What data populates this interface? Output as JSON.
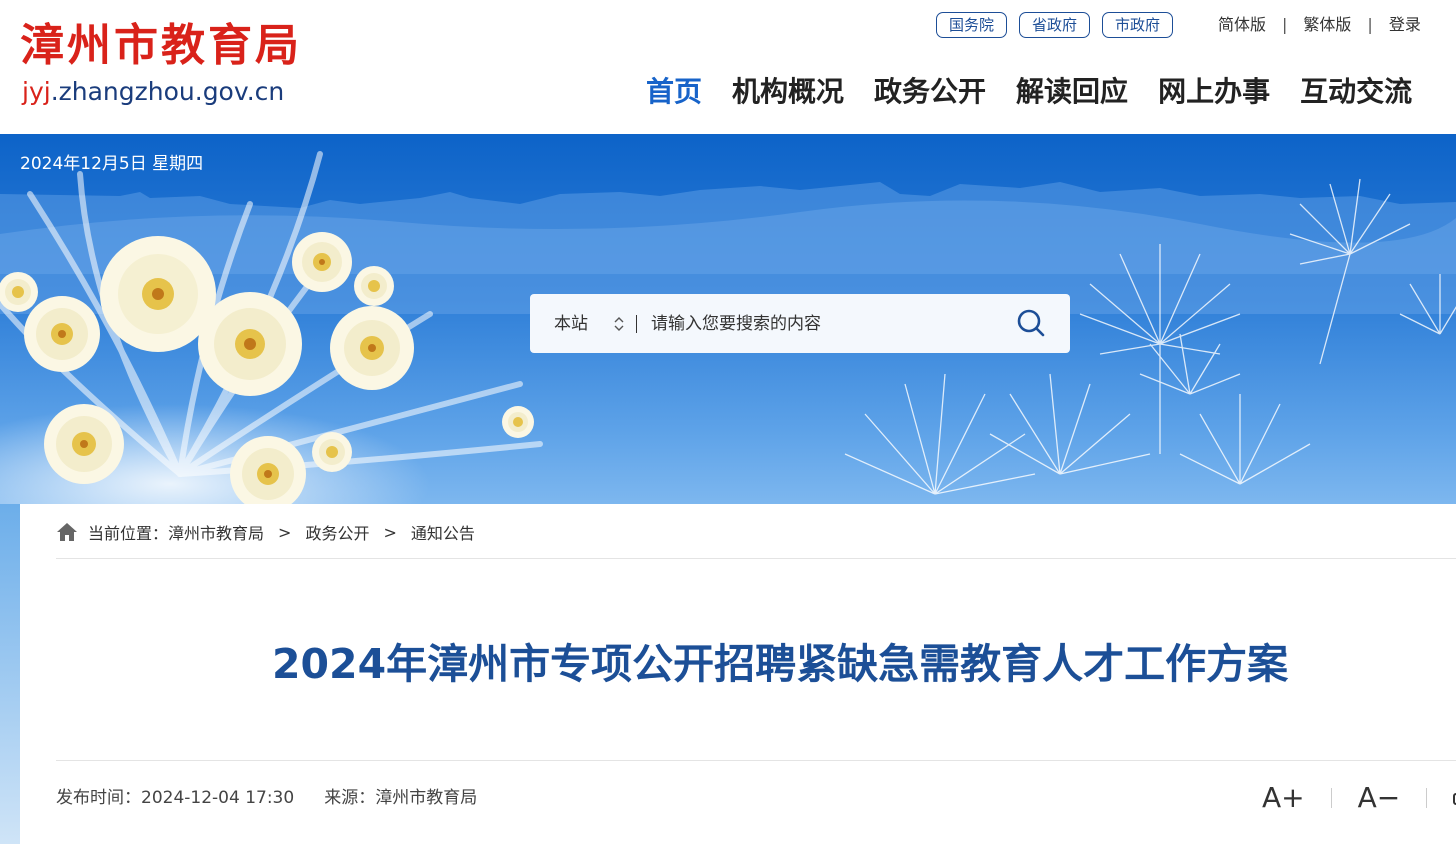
{
  "header": {
    "site_title": "漳州市教育局",
    "site_url_prefix": "jyj",
    "site_url_rest": ".zhangzhou.gov.cn",
    "gov_links": [
      {
        "label": "国务院"
      },
      {
        "label": "省政府"
      },
      {
        "label": "市政府"
      }
    ],
    "util_links": {
      "simplified": "简体版",
      "traditional": "繁体版",
      "login": "登录",
      "separator": "|"
    },
    "nav": [
      {
        "label": "首页",
        "active": true
      },
      {
        "label": "机构概况",
        "active": false
      },
      {
        "label": "政务公开",
        "active": false
      },
      {
        "label": "解读回应",
        "active": false
      },
      {
        "label": "网上办事",
        "active": false
      },
      {
        "label": "互动交流",
        "active": false
      }
    ]
  },
  "banner": {
    "date": "2024年12月5日 星期四",
    "search": {
      "scope": "本站",
      "divider": "|",
      "placeholder": "请输入您要搜索的内容"
    }
  },
  "breadcrumb": {
    "prefix": "当前位置：",
    "items": [
      "漳州市教育局",
      "政务公开",
      "通知公告"
    ],
    "separator": ">"
  },
  "article": {
    "title": "2024年漳州市专项公开招聘紧缺急需教育人才工作方案",
    "publish_label": "发布时间：",
    "publish_time": "2024-12-04 17:30",
    "source_label": "来源：",
    "source": "漳州市教育局"
  },
  "tools": {
    "increase": "A+",
    "decrease": "A−"
  },
  "colors": {
    "brand_red": "#d9221a",
    "nav_active": "#1763c9",
    "title_blue": "#1c4f97",
    "banner_blue": "#0d63c8"
  }
}
